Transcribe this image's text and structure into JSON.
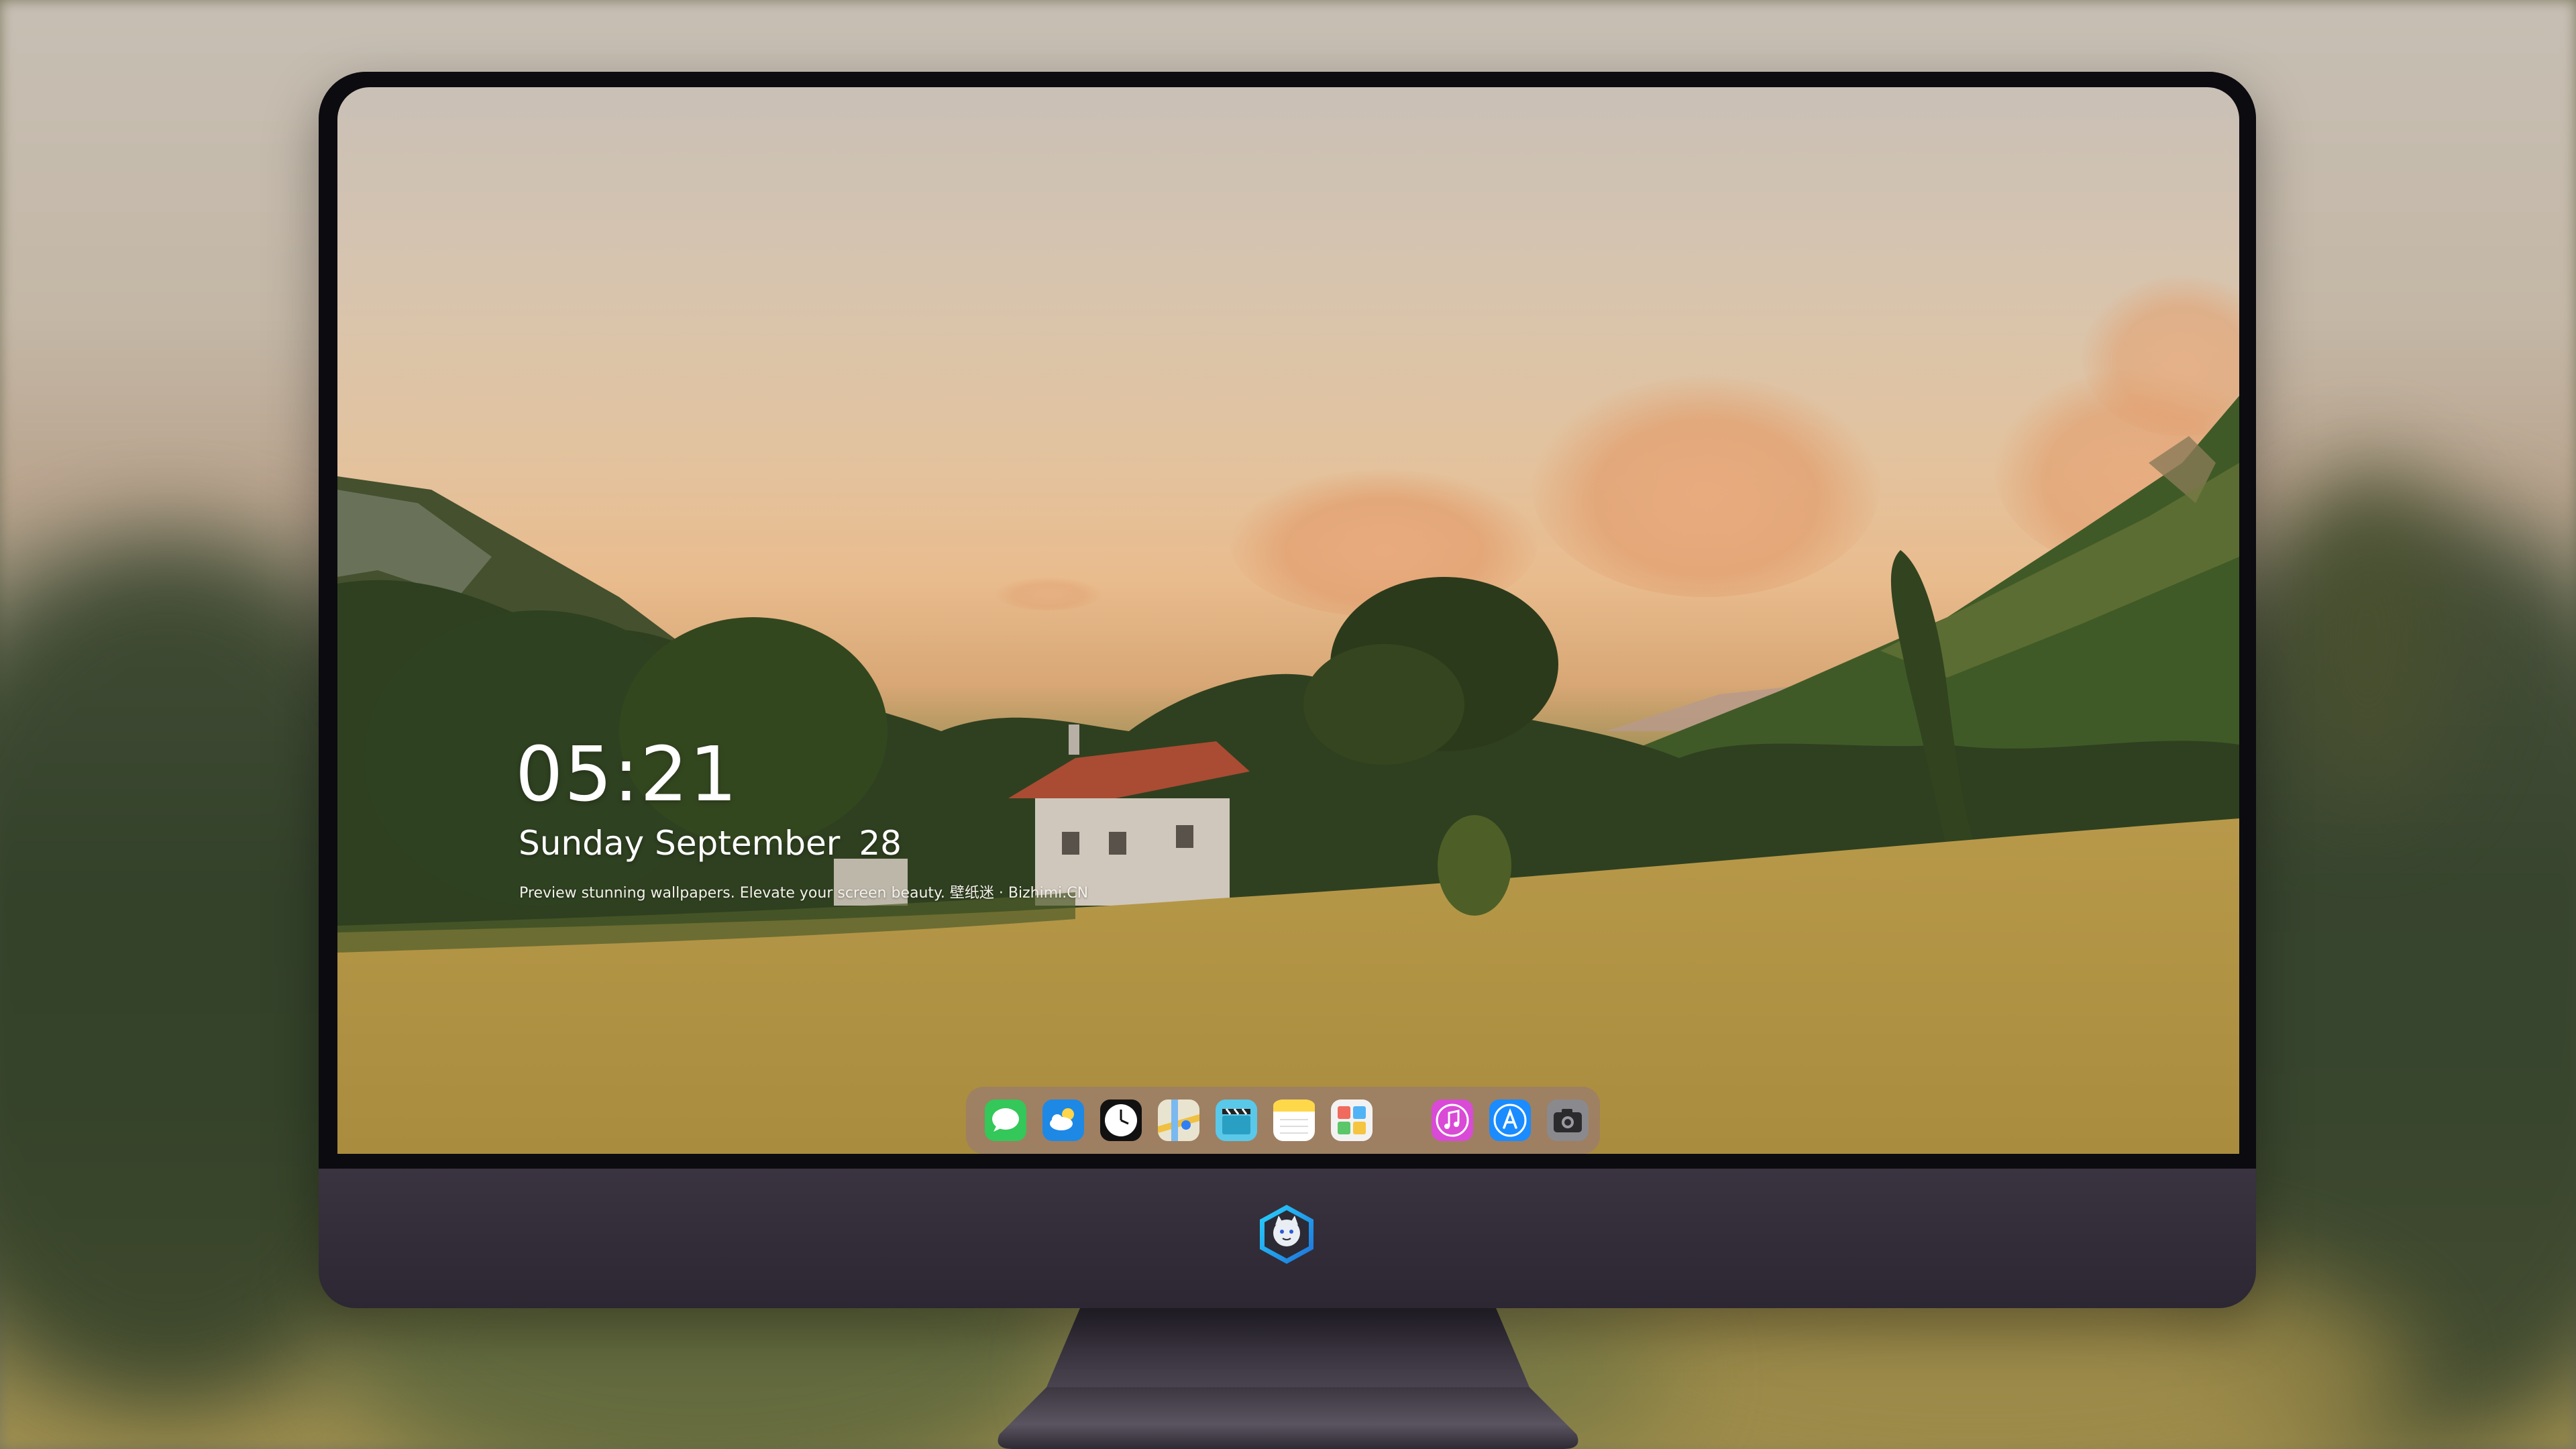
{
  "lock_screen": {
    "time": "05:21",
    "weekday_month": "Sunday September",
    "day": "28",
    "tagline": "Preview stunning wallpapers. Elevate your screen beauty. 壁纸迷 · Bizhimi.CN"
  },
  "dock": {
    "apps": [
      {
        "name": "Messages",
        "icon": "message-bubble-icon",
        "color": "#34c759"
      },
      {
        "name": "Weather",
        "icon": "cloud-sun-icon",
        "color": "#1e88e5"
      },
      {
        "name": "Clock",
        "icon": "clock-icon",
        "color": "#111111"
      },
      {
        "name": "Maps",
        "icon": "map-icon",
        "color": "#f0c040"
      },
      {
        "name": "Videos",
        "icon": "clapperboard-icon",
        "color": "#5ac8e8"
      },
      {
        "name": "Notes",
        "icon": "notes-icon",
        "color": "#ffd84a"
      },
      {
        "name": "Photos",
        "icon": "photo-grid-icon",
        "color": "#e8e8e8"
      }
    ],
    "pinned": [
      {
        "name": "Music",
        "icon": "music-note-icon",
        "color": "#d94ad6"
      },
      {
        "name": "App Store",
        "icon": "app-store-icon",
        "color": "#1a8cff"
      },
      {
        "name": "Camera",
        "icon": "camera-icon",
        "color": "#8a8a8e"
      }
    ]
  },
  "colors": {
    "monitor_body": "#2a2630",
    "bezel": "#0c0b10",
    "dock_background": "#967878"
  }
}
